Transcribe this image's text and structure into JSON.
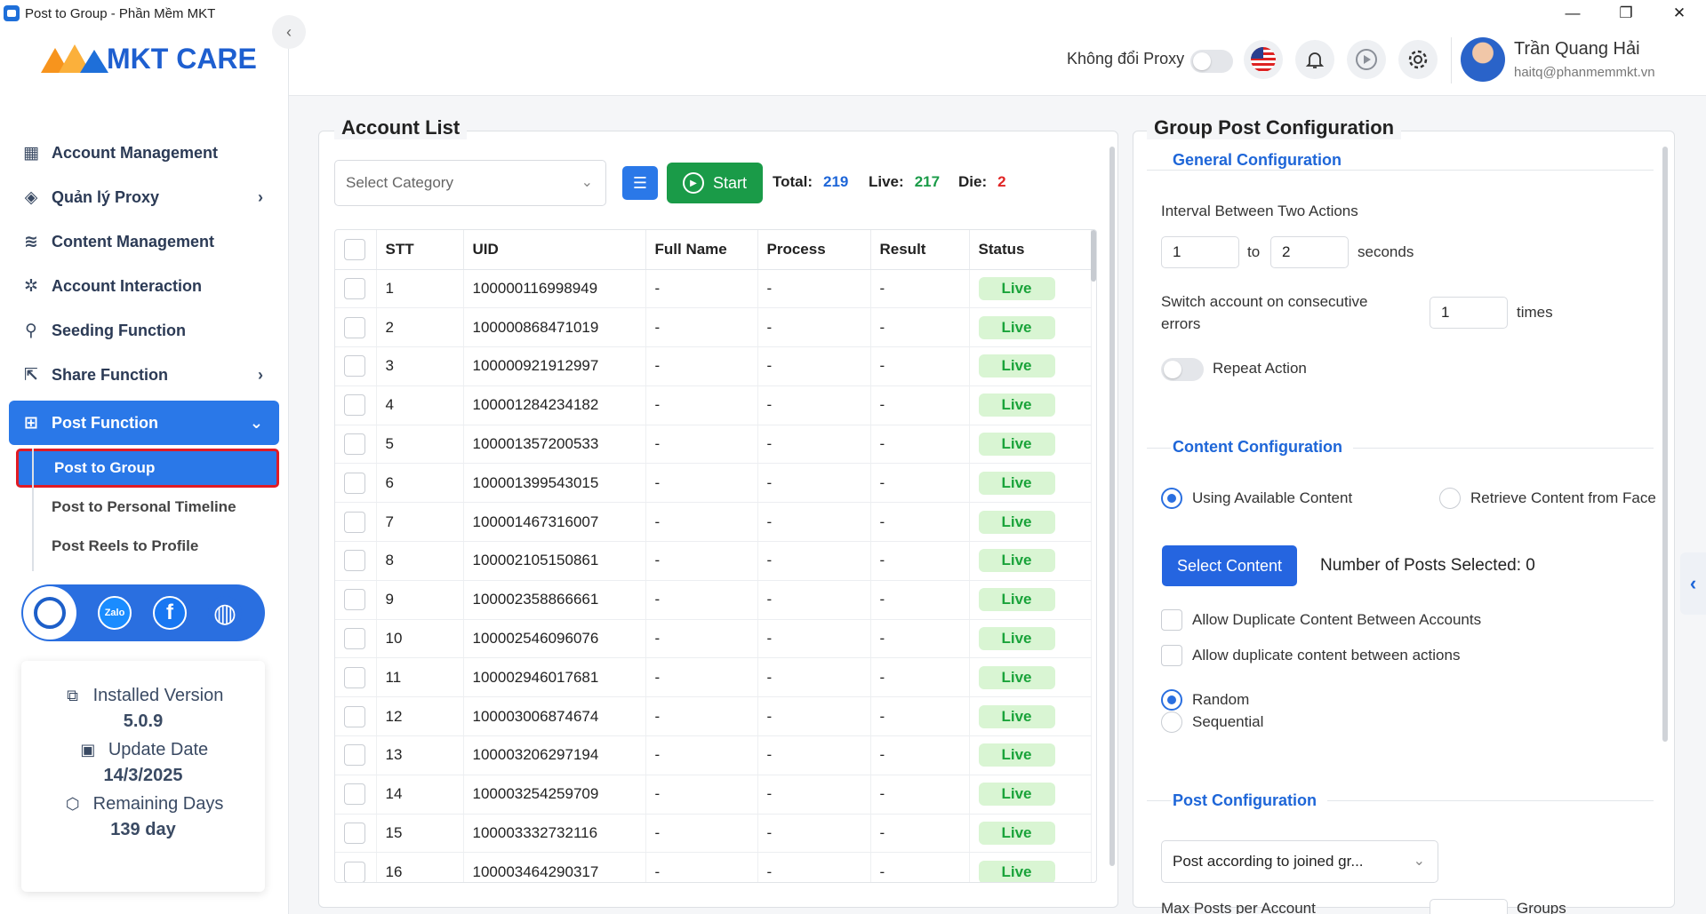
{
  "window": {
    "title": "Post to Group - Phần Mềm MKT",
    "minimize": "—",
    "restore": "❐",
    "close": "✕"
  },
  "logo": {
    "text": "MKT CARE"
  },
  "sidebar": {
    "collapse_icon": "‹",
    "items": [
      {
        "label": "Account Management",
        "icon": "▦",
        "has_chevron": false
      },
      {
        "label": "Quản lý Proxy",
        "icon": "◈",
        "has_chevron": true
      },
      {
        "label": "Content Management",
        "icon": "≋",
        "has_chevron": false
      },
      {
        "label": "Account Interaction",
        "icon": "✲",
        "has_chevron": false
      },
      {
        "label": "Seeding Function",
        "icon": "⚲",
        "has_chevron": false
      },
      {
        "label": "Share Function",
        "icon": "⇱",
        "has_chevron": true
      },
      {
        "label": "Post Function",
        "icon": "⊞",
        "has_chevron": true,
        "active": true
      }
    ],
    "chevron": "›",
    "chevron_down": "⌄",
    "sub_items": [
      {
        "label": "Post to Group",
        "active": true
      },
      {
        "label": "Post to Personal Timeline"
      },
      {
        "label": "Post Reels to Profile"
      }
    ]
  },
  "social": {
    "zalo": "Zalo",
    "facebook": "f",
    "web": "◍"
  },
  "version_card": {
    "installed_label": "Installed Version",
    "installed_value": "5.0.9",
    "update_label": "Update Date",
    "update_value": "14/3/2025",
    "remaining_label": "Remaining Days",
    "remaining_value": "139 day"
  },
  "topbar": {
    "proxy_label": "Không đổi Proxy",
    "user_name": "Trần Quang Hải",
    "user_email": "haitq@phanmemmkt.vn"
  },
  "account_list": {
    "title": "Account List",
    "category_placeholder": "Select Category",
    "start_label": "Start",
    "total_label": "Total:",
    "total_value": "219",
    "live_label": "Live:",
    "live_value": "217",
    "die_label": "Die:",
    "die_value": "2",
    "colors": {
      "total": "#1e66d8",
      "live": "#1a9b48",
      "die": "#e02424"
    },
    "columns": [
      "STT",
      "UID",
      "Full Name",
      "Process",
      "Result",
      "Status"
    ],
    "rows": [
      [
        "1",
        "100000116998949",
        "-",
        "-",
        "-",
        "Live"
      ],
      [
        "2",
        "100000868471019",
        "-",
        "-",
        "-",
        "Live"
      ],
      [
        "3",
        "100000921912997",
        "-",
        "-",
        "-",
        "Live"
      ],
      [
        "4",
        "100001284234182",
        "-",
        "-",
        "-",
        "Live"
      ],
      [
        "5",
        "100001357200533",
        "-",
        "-",
        "-",
        "Live"
      ],
      [
        "6",
        "100001399543015",
        "-",
        "-",
        "-",
        "Live"
      ],
      [
        "7",
        "100001467316007",
        "-",
        "-",
        "-",
        "Live"
      ],
      [
        "8",
        "100002105150861",
        "-",
        "-",
        "-",
        "Live"
      ],
      [
        "9",
        "100002358866661",
        "-",
        "-",
        "-",
        "Live"
      ],
      [
        "10",
        "100002546096076",
        "-",
        "-",
        "-",
        "Live"
      ],
      [
        "11",
        "100002946017681",
        "-",
        "-",
        "-",
        "Live"
      ],
      [
        "12",
        "100003006874674",
        "-",
        "-",
        "-",
        "Live"
      ],
      [
        "13",
        "100003206297194",
        "-",
        "-",
        "-",
        "Live"
      ],
      [
        "14",
        "100003254259709",
        "-",
        "-",
        "-",
        "Live"
      ],
      [
        "15",
        "100003332732116",
        "-",
        "-",
        "-",
        "Live"
      ],
      [
        "16",
        "100003464290317",
        "-",
        "-",
        "-",
        "Live"
      ]
    ]
  },
  "config": {
    "title": "Group Post Configuration",
    "general_title": "General Configuration",
    "interval_label": "Interval Between Two Actions",
    "interval_from": "1",
    "interval_to_label": "to",
    "interval_to": "2",
    "interval_unit": "seconds",
    "switch_label_1": "Switch account on consecutive",
    "switch_label_2": "errors",
    "switch_value": "1",
    "switch_unit": "times",
    "repeat_label": "Repeat Action",
    "content_title": "Content Configuration",
    "using_available": "Using Available Content",
    "retrieve_content": "Retrieve Content from Face",
    "select_content_btn": "Select Content",
    "posts_selected": "Number of Posts Selected: 0",
    "allow_dup_accounts": "Allow Duplicate Content Between Accounts",
    "allow_dup_actions": "Allow duplicate content between actions",
    "random": "Random",
    "sequential": "Sequential",
    "post_title": "Post Configuration",
    "post_mode": "Post according to joined gr...",
    "max_posts_label": "Max Posts per Account",
    "max_posts_unit": "Groups"
  }
}
